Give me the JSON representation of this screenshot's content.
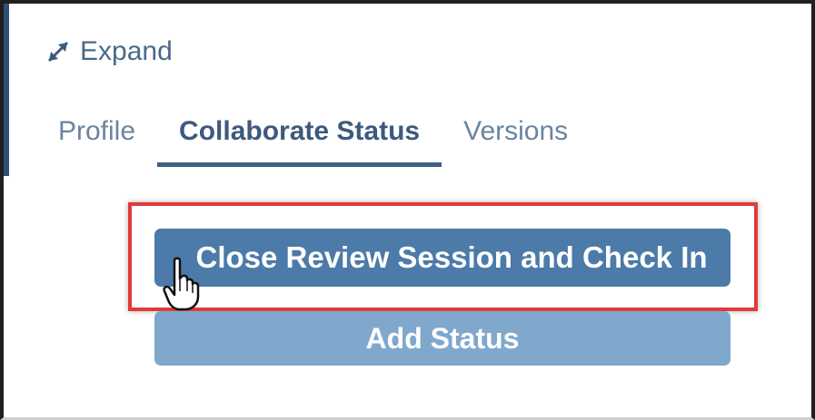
{
  "header": {
    "expand_label": "Expand",
    "expand_icon": "expand-arrows-icon"
  },
  "tabs": [
    {
      "label": "Profile",
      "active": false
    },
    {
      "label": "Collaborate Status",
      "active": true
    },
    {
      "label": "Versions",
      "active": false
    }
  ],
  "actions": {
    "close_review_label": "Close Review Session and Check In",
    "add_status_label": "Add Status"
  },
  "annotation": {
    "highlight_color": "#e03b3b",
    "cursor_icon": "hand-pointer-icon"
  },
  "colors": {
    "primary_button": "#4c7aa9",
    "secondary_button": "#7fa8cc",
    "tab_active": "#3d5a7d",
    "tab_inactive": "#6c84a0",
    "tab_underline": "#3f5f86"
  }
}
